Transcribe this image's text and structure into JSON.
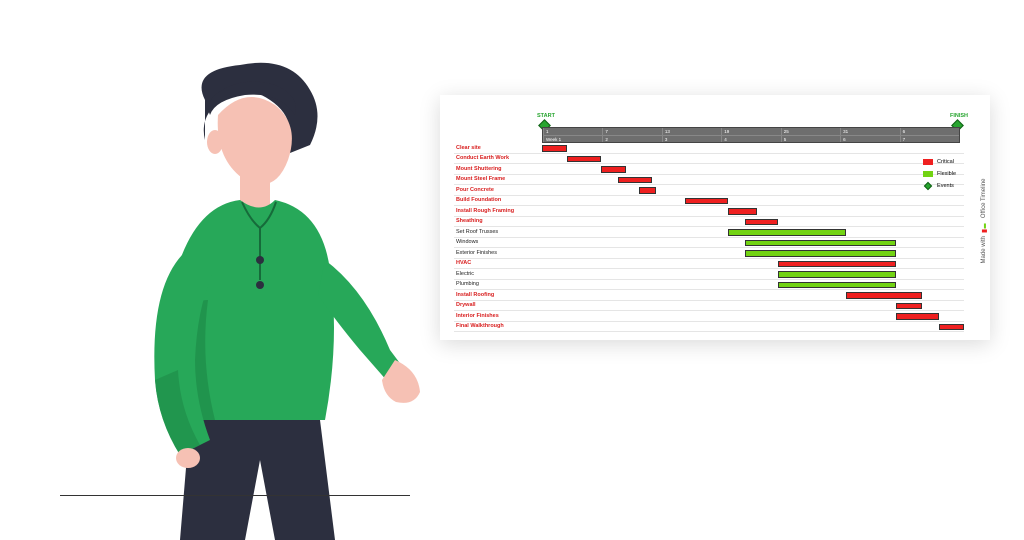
{
  "chart_data": {
    "type": "gantt",
    "milestones": {
      "start_label": "START",
      "finish_label": "FINISH"
    },
    "legend": {
      "critical": "Critical",
      "flexible": "Flexible",
      "events": "Events"
    },
    "axis": {
      "weeks": [
        "Week 1",
        "2",
        "3",
        "4",
        "5",
        "6",
        "7"
      ],
      "dates": [
        "1",
        "7",
        "13",
        "19",
        "25",
        "31",
        "6"
      ]
    },
    "tasks": [
      {
        "name": "Clear site",
        "type": "critical",
        "start": 0,
        "end": 6
      },
      {
        "name": "Conduct Earth Work",
        "type": "critical",
        "start": 6,
        "end": 14
      },
      {
        "name": "Mount Shuttering",
        "type": "critical",
        "start": 14,
        "end": 20
      },
      {
        "name": "Mount Steel Frame",
        "type": "critical",
        "start": 18,
        "end": 26
      },
      {
        "name": "Pour Concrete",
        "type": "critical",
        "start": 23,
        "end": 27
      },
      {
        "name": "Build Foundation",
        "type": "critical",
        "start": 34,
        "end": 44
      },
      {
        "name": "Install Rough Framing",
        "type": "critical",
        "start": 44,
        "end": 51
      },
      {
        "name": "Sheathing",
        "type": "critical",
        "start": 48,
        "end": 56
      },
      {
        "name": "Set Roof Trusses",
        "type": "flexible",
        "start": 44,
        "end": 72
      },
      {
        "name": "Windows",
        "type": "flexible",
        "start": 48,
        "end": 84
      },
      {
        "name": "Exterior Finishes",
        "type": "flexible",
        "start": 48,
        "end": 84
      },
      {
        "name": "HVAC",
        "type": "critical",
        "start": 56,
        "end": 84
      },
      {
        "name": "Electric",
        "type": "flexible",
        "start": 56,
        "end": 84
      },
      {
        "name": "Plumbing",
        "type": "flexible",
        "start": 56,
        "end": 84
      },
      {
        "name": "Install Roofing",
        "type": "critical",
        "start": 72,
        "end": 90
      },
      {
        "name": "Drywall",
        "type": "critical",
        "start": 84,
        "end": 90
      },
      {
        "name": "Interior Finishes",
        "type": "critical",
        "start": 84,
        "end": 94
      },
      {
        "name": "Final Walkthrough",
        "type": "critical",
        "start": 94,
        "end": 100
      }
    ],
    "attribution": {
      "prefix": "Made with",
      "brand": "Office Timeline"
    },
    "colors": {
      "critical": "#ef2020",
      "flexible": "#72d313",
      "event": "#27a52f",
      "axis": "#6e6e6e"
    }
  }
}
